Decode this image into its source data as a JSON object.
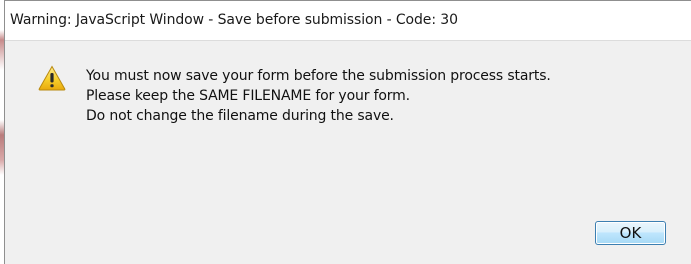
{
  "dialog": {
    "title": "Warning: JavaScript Window - Save before submission - Code: 30",
    "icon": "warning-triangle-icon",
    "message_lines": [
      "You must now save your form before the submission process starts.",
      "Please keep the SAME FILENAME for your form.",
      "Do not change the filename during the save."
    ],
    "ok_label": "OK"
  },
  "colors": {
    "dialog_background": "#f0f0f0",
    "titlebar_background": "#ffffff",
    "button_border": "#3c7fb1",
    "warning_yellow": "#f5c81e"
  }
}
